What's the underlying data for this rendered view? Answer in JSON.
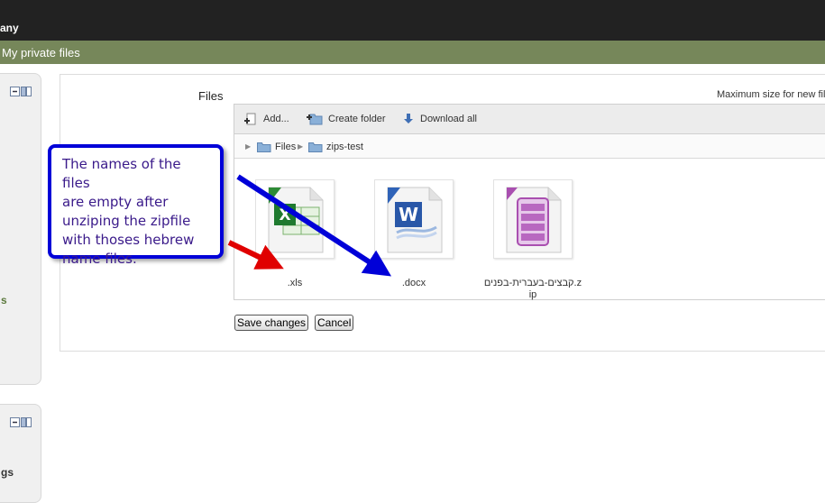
{
  "header": {
    "site_name": "any"
  },
  "navbar": {
    "title": "My private files"
  },
  "sidebar": {
    "block1_text": "s",
    "block2_text": "gs"
  },
  "form": {
    "files_label": "Files",
    "max_size_text": "Maximum size for new fil",
    "toolbar": {
      "add": "Add...",
      "create_folder": "Create folder",
      "download_all": "Download all"
    },
    "path": [
      "Files",
      "zips-test"
    ],
    "files": [
      {
        "name": ".xls",
        "icon": "excel-file-icon"
      },
      {
        "name": ".docx",
        "icon": "word-file-icon"
      },
      {
        "name": "קבצים-בעברית-בפנים.zip",
        "icon": "zip-archive-icon"
      }
    ],
    "save_label": "Save changes",
    "cancel_label": "Cancel"
  },
  "annotation": {
    "lines": [
      "The names of the files",
      "are empty after",
      "unziping the zipfile",
      "with thoses hebrew",
      "name files."
    ]
  },
  "colors": {
    "topbar": "#222222",
    "navbar": "#76875a",
    "callout_border": "#0000d8",
    "arrow_red": "#e00000",
    "arrow_blue": "#0000d8"
  }
}
